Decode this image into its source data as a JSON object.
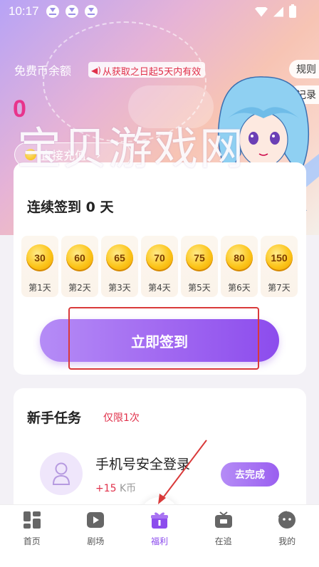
{
  "status_bar": {
    "time": "10:17",
    "icons": [
      "download-icon",
      "download-icon",
      "download-icon",
      "wifi-icon",
      "signal-icon",
      "battery-icon"
    ]
  },
  "balance": {
    "label": "免费币余额",
    "validity": "从获取之日起5天内有效",
    "value": "0",
    "recharge_label": "直接充值",
    "rules_label": "规则",
    "records_label": "记录"
  },
  "watermark": "宝贝游戏网",
  "signin": {
    "title": "连续签到 0 天",
    "days": [
      {
        "coins": "30",
        "label": "第1天"
      },
      {
        "coins": "60",
        "label": "第2天"
      },
      {
        "coins": "65",
        "label": "第3天"
      },
      {
        "coins": "70",
        "label": "第4天"
      },
      {
        "coins": "75",
        "label": "第5天"
      },
      {
        "coins": "80",
        "label": "第6天"
      },
      {
        "coins": "150",
        "label": "第7天"
      }
    ],
    "button_label": "立即签到"
  },
  "tasks": {
    "title": "新手任务",
    "limit": "仅限1次",
    "items": [
      {
        "name": "手机号安全登录",
        "reward_prefix": "+15",
        "reward_unit": "K币",
        "action": "去完成"
      }
    ]
  },
  "nav": [
    {
      "label": "首页",
      "icon": "home-grid-icon"
    },
    {
      "label": "剧场",
      "icon": "play-icon"
    },
    {
      "label": "福利",
      "icon": "gift-icon",
      "active": true
    },
    {
      "label": "在追",
      "icon": "tv-icon"
    },
    {
      "label": "我的",
      "icon": "profile-face-icon"
    }
  ],
  "colors": {
    "accent": "#8c4ced",
    "balance_value": "#e8348c",
    "warning": "#e0304a"
  }
}
